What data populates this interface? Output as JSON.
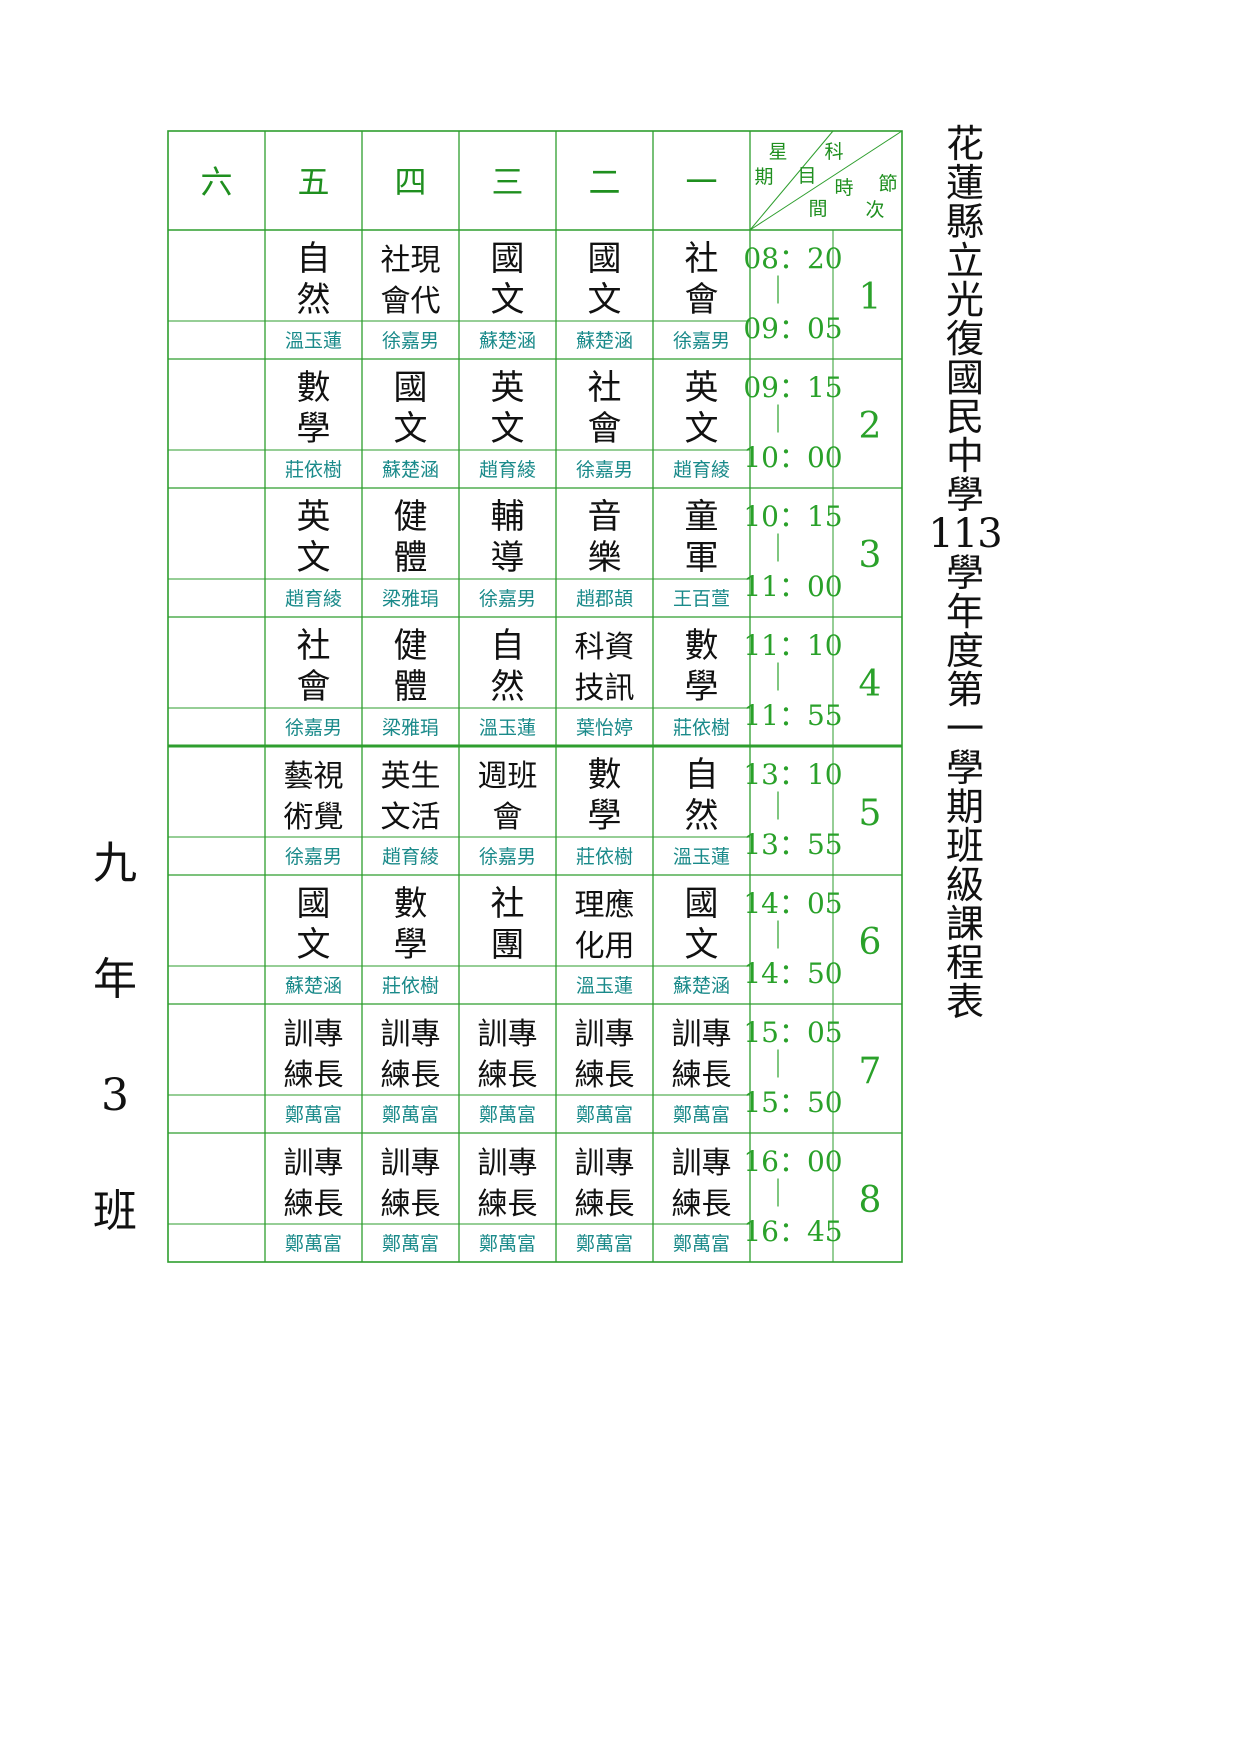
{
  "title_chars": [
    "花",
    "蓮",
    "縣",
    "立",
    "光",
    "復",
    "國",
    "民",
    "中",
    "學",
    "113",
    "學",
    "年",
    "度",
    "第",
    "一",
    "學",
    "期",
    "班",
    "級",
    "課",
    "程",
    "表"
  ],
  "class_label_chars": [
    "九",
    "年",
    "3",
    "班"
  ],
  "header": {
    "days": [
      "一",
      "二",
      "三",
      "四",
      "五",
      "六"
    ],
    "corner": {
      "xing": "星",
      "qi": "期",
      "ke": "科",
      "mu": "目",
      "shi": "時",
      "jian": "間",
      "jie": "節",
      "ci": "次"
    }
  },
  "periods": [
    {
      "number": "1",
      "start": "08：20",
      "end": "09：05",
      "sep": "｜"
    },
    {
      "number": "2",
      "start": "09：15",
      "end": "10：00",
      "sep": "｜"
    },
    {
      "number": "3",
      "start": "10：15",
      "end": "11：00",
      "sep": "｜"
    },
    {
      "number": "4",
      "start": "11：10",
      "end": "11：55",
      "sep": "｜"
    },
    {
      "number": "5",
      "start": "13：10",
      "end": "13：55",
      "sep": "｜"
    },
    {
      "number": "6",
      "start": "14：05",
      "end": "14：50",
      "sep": "｜"
    },
    {
      "number": "7",
      "start": "15：05",
      "end": "15：50",
      "sep": "｜"
    },
    {
      "number": "8",
      "start": "16：00",
      "end": "16：45",
      "sep": "｜"
    }
  ],
  "schedule": [
    [
      {
        "lines": [
          "社",
          "會"
        ],
        "teacher": "徐嘉男"
      },
      {
        "lines": [
          "國",
          "文"
        ],
        "teacher": "蘇楚涵"
      },
      {
        "lines": [
          "國",
          "文"
        ],
        "teacher": "蘇楚涵"
      },
      {
        "lines": [
          "社現",
          "會代"
        ],
        "teacher": "徐嘉男"
      },
      {
        "lines": [
          "自",
          "然"
        ],
        "teacher": "溫玉蓮"
      },
      {
        "lines": [],
        "teacher": ""
      }
    ],
    [
      {
        "lines": [
          "英",
          "文"
        ],
        "teacher": "趙育綾"
      },
      {
        "lines": [
          "社",
          "會"
        ],
        "teacher": "徐嘉男"
      },
      {
        "lines": [
          "英",
          "文"
        ],
        "teacher": "趙育綾"
      },
      {
        "lines": [
          "國",
          "文"
        ],
        "teacher": "蘇楚涵"
      },
      {
        "lines": [
          "數",
          "學"
        ],
        "teacher": "莊依樹"
      },
      {
        "lines": [],
        "teacher": ""
      }
    ],
    [
      {
        "lines": [
          "童",
          "軍"
        ],
        "teacher": "王百萱"
      },
      {
        "lines": [
          "音",
          "樂"
        ],
        "teacher": "趙郡頡"
      },
      {
        "lines": [
          "輔",
          "導"
        ],
        "teacher": "徐嘉男"
      },
      {
        "lines": [
          "健",
          "體"
        ],
        "teacher": "梁雅琄"
      },
      {
        "lines": [
          "英",
          "文"
        ],
        "teacher": "趙育綾"
      },
      {
        "lines": [],
        "teacher": ""
      }
    ],
    [
      {
        "lines": [
          "數",
          "學"
        ],
        "teacher": "莊依樹"
      },
      {
        "lines": [
          "科資",
          "技訊"
        ],
        "teacher": "葉怡婷"
      },
      {
        "lines": [
          "自",
          "然"
        ],
        "teacher": "溫玉蓮"
      },
      {
        "lines": [
          "健",
          "體"
        ],
        "teacher": "梁雅琄"
      },
      {
        "lines": [
          "社",
          "會"
        ],
        "teacher": "徐嘉男"
      },
      {
        "lines": [],
        "teacher": ""
      }
    ],
    [
      {
        "lines": [
          "自",
          "然"
        ],
        "teacher": "溫玉蓮"
      },
      {
        "lines": [
          "數",
          "學"
        ],
        "teacher": "莊依樹"
      },
      {
        "lines": [
          "週班",
          "會"
        ],
        "teacher": "徐嘉男"
      },
      {
        "lines": [
          "英生",
          "文活"
        ],
        "teacher": "趙育綾"
      },
      {
        "lines": [
          "藝視",
          "術覺"
        ],
        "teacher": "徐嘉男"
      },
      {
        "lines": [],
        "teacher": ""
      }
    ],
    [
      {
        "lines": [
          "國",
          "文"
        ],
        "teacher": "蘇楚涵"
      },
      {
        "lines": [
          "理應",
          "化用"
        ],
        "teacher": "溫玉蓮"
      },
      {
        "lines": [
          "社",
          "團"
        ],
        "teacher": ""
      },
      {
        "lines": [
          "數",
          "學"
        ],
        "teacher": "莊依樹"
      },
      {
        "lines": [
          "國",
          "文"
        ],
        "teacher": "蘇楚涵"
      },
      {
        "lines": [],
        "teacher": ""
      }
    ],
    [
      {
        "lines": [
          "訓專",
          "練長"
        ],
        "teacher": "鄭萬富"
      },
      {
        "lines": [
          "訓專",
          "練長"
        ],
        "teacher": "鄭萬富"
      },
      {
        "lines": [
          "訓專",
          "練長"
        ],
        "teacher": "鄭萬富"
      },
      {
        "lines": [
          "訓專",
          "練長"
        ],
        "teacher": "鄭萬富"
      },
      {
        "lines": [
          "訓專",
          "練長"
        ],
        "teacher": "鄭萬富"
      },
      {
        "lines": [],
        "teacher": ""
      }
    ],
    [
      {
        "lines": [
          "訓專",
          "練長"
        ],
        "teacher": "鄭萬富"
      },
      {
        "lines": [
          "訓專",
          "練長"
        ],
        "teacher": "鄭萬富"
      },
      {
        "lines": [
          "訓專",
          "練長"
        ],
        "teacher": "鄭萬富"
      },
      {
        "lines": [
          "訓專",
          "練長"
        ],
        "teacher": "鄭萬富"
      },
      {
        "lines": [
          "訓專",
          "練長"
        ],
        "teacher": "鄭萬富"
      },
      {
        "lines": [],
        "teacher": ""
      }
    ]
  ],
  "colors": {
    "grid": "#2e9e2e",
    "teacher": "#1a8a8a",
    "day": "#1f8f1f",
    "text": "#111111"
  }
}
